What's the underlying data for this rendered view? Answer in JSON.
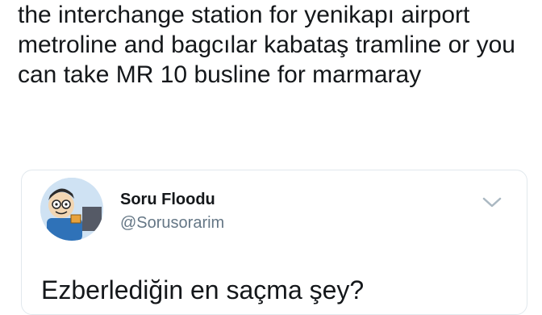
{
  "reply": {
    "text": "the interchange station for yenikapı airport metroline and bagcılar kabataş tramline or you can take MR 10 busline for marmaray"
  },
  "quoted_tweet": {
    "display_name": "Soru Floodu",
    "handle": "@Sorusorarim",
    "text": "Ezberlediğin en saçma şey?",
    "avatar_icon": "cartoon-character-avatar",
    "menu_icon": "chevron-down-icon"
  },
  "colors": {
    "text_primary": "#14171a",
    "text_secondary": "#657786",
    "border": "#e1e8ed"
  }
}
